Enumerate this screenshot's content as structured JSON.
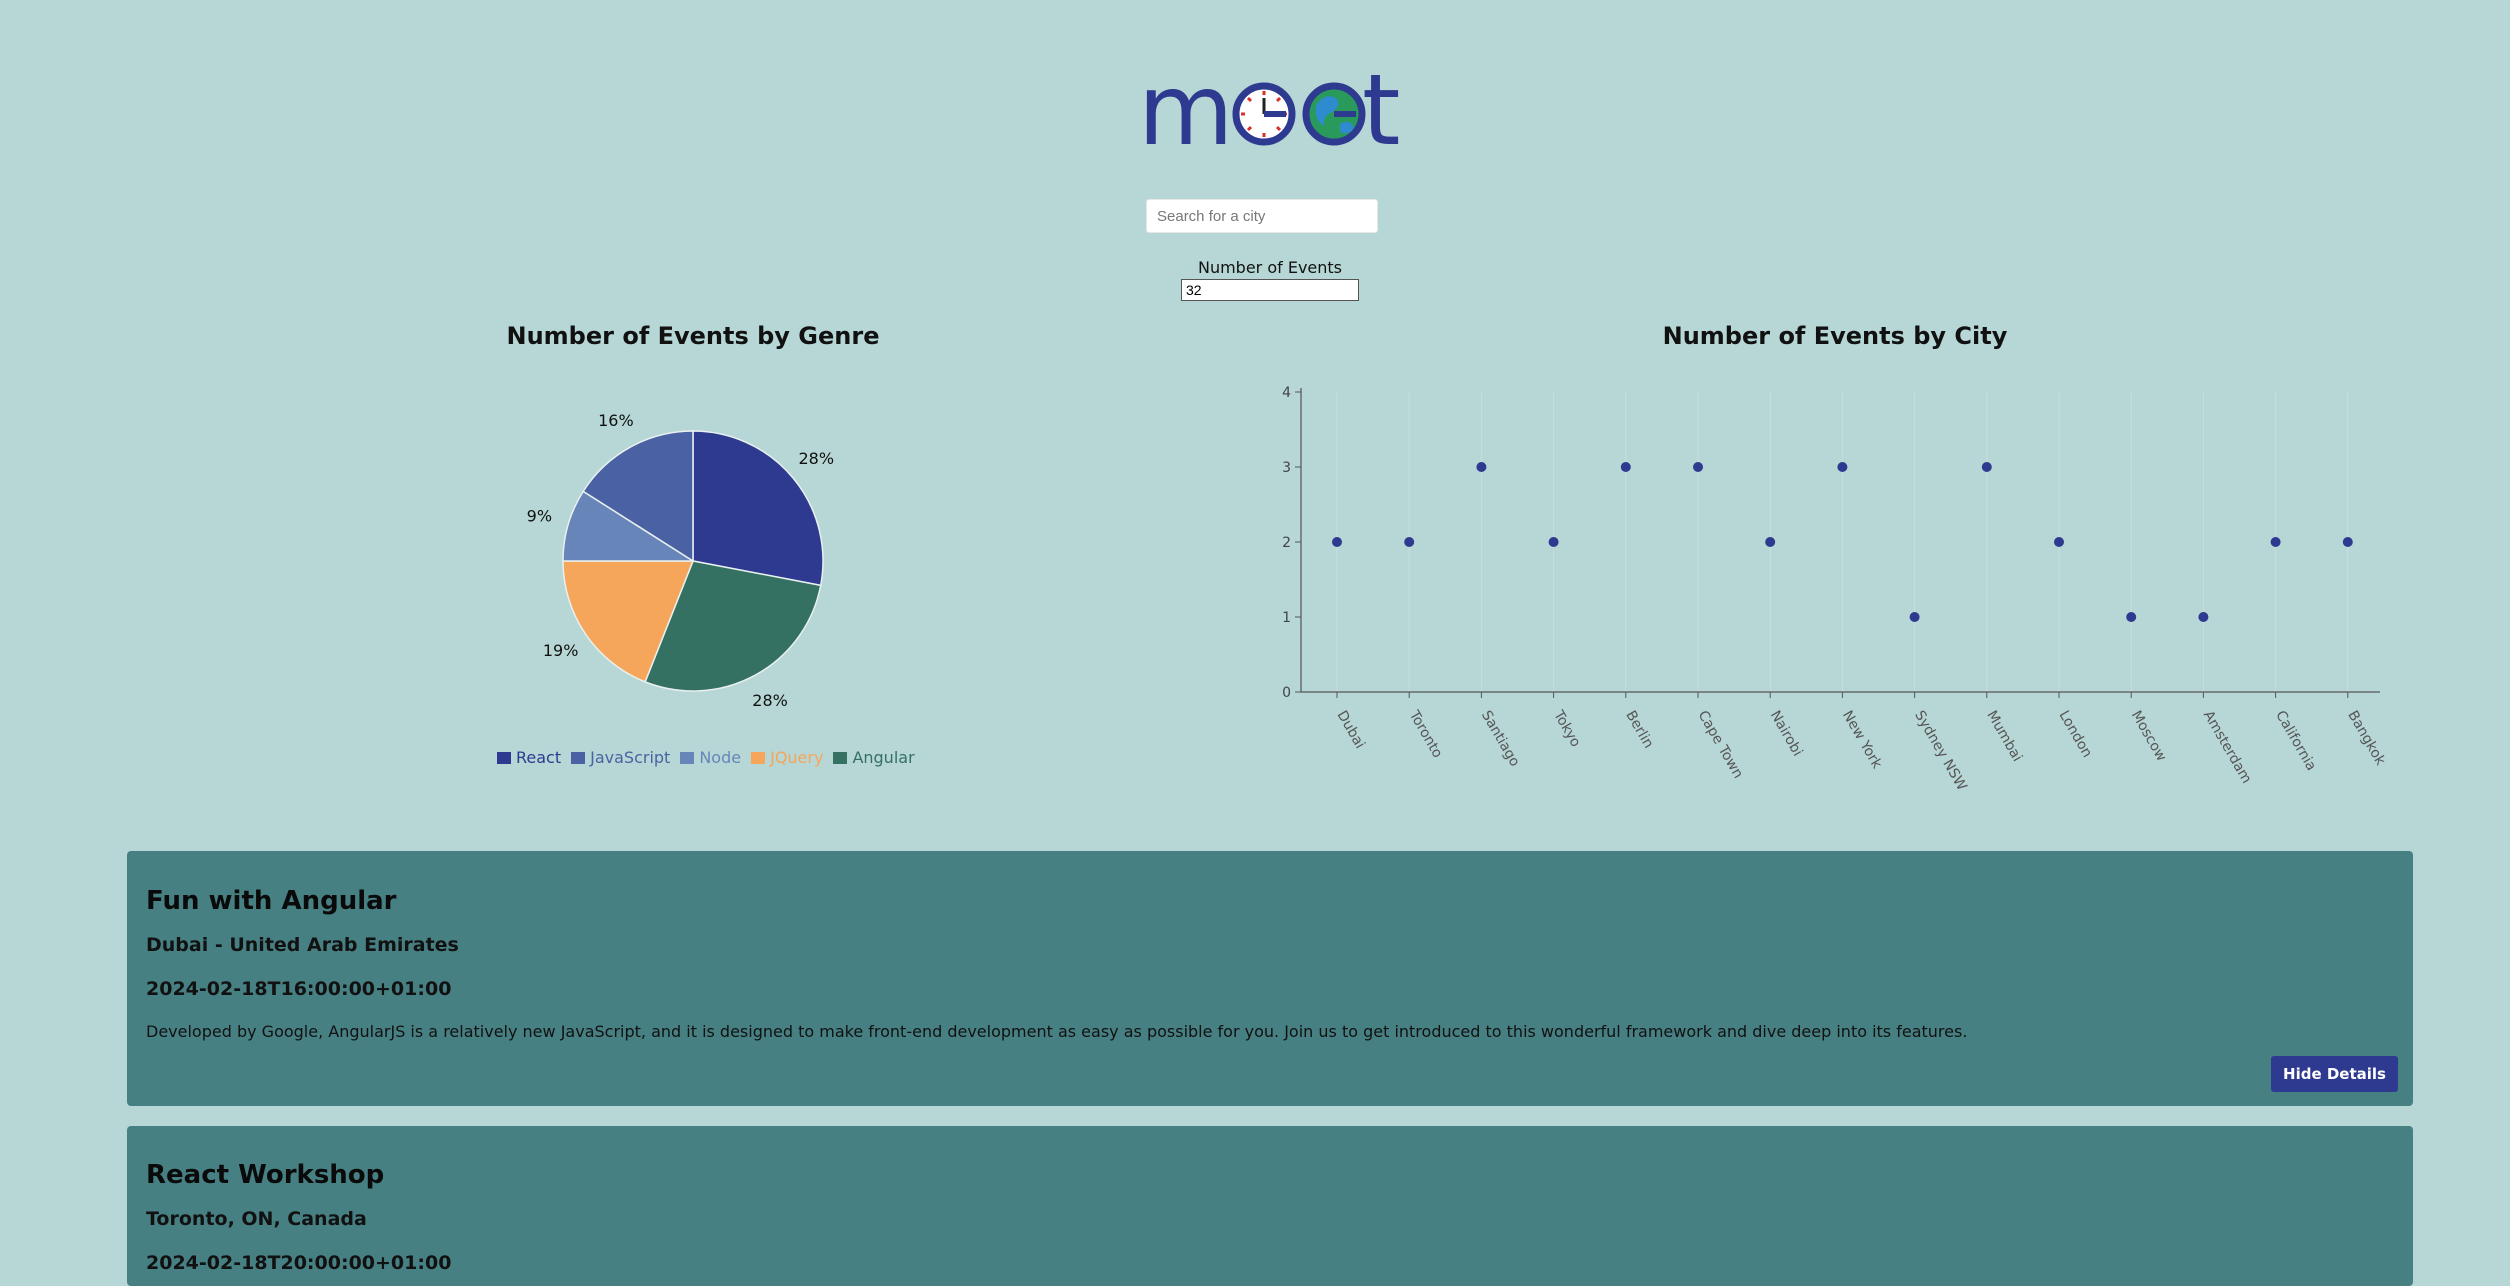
{
  "logo": {
    "text_m": "m",
    "text_t": "t",
    "icon1": "clock-icon",
    "icon2": "globe-icon"
  },
  "search": {
    "placeholder": "Search for a city",
    "value": ""
  },
  "number_of_events": {
    "label": "Number of Events",
    "value": "32"
  },
  "colors": {
    "background": "#b7d6d6",
    "card": "#478083",
    "button": "#2e3a8f",
    "react": "#2e3a8f",
    "javascript": "#4a62a4",
    "node": "#6785b9",
    "jquery": "#f6a65a",
    "angular": "#347163",
    "dot": "#2e3a8f"
  },
  "chart_data": [
    {
      "type": "pie",
      "title": "Number of Events by Genre",
      "labels": [
        "React",
        "JavaScript",
        "Node",
        "JQuery",
        "Angular"
      ],
      "values": [
        28,
        16,
        9,
        19,
        28
      ],
      "value_labels": [
        "28%",
        "16%",
        "9%",
        "19%",
        "28%"
      ],
      "legend": "bottom"
    },
    {
      "type": "scatter",
      "title": "Number of Events by City",
      "categories": [
        "Dubai",
        "Toronto",
        "Santiago",
        "Tokyo",
        "Berlin",
        "Cape Town",
        "Nairobi",
        "New York",
        "Sydney NSW",
        "Mumbai",
        "London",
        "Moscow",
        "Amsterdam",
        "California",
        "Bangkok"
      ],
      "values": [
        2,
        2,
        3,
        2,
        3,
        3,
        2,
        3,
        1,
        3,
        2,
        1,
        1,
        2,
        2
      ],
      "ylim": [
        0,
        4
      ],
      "yticks": [
        "0",
        "1",
        "2",
        "3",
        "4"
      ],
      "grid": true
    }
  ],
  "events": [
    {
      "title": "Fun with Angular",
      "location": "Dubai - United Arab Emirates",
      "date": "2024-02-18T16:00:00+01:00",
      "description": "Developed by Google, AngularJS is a relatively new JavaScript, and it is designed to make front-end development as easy as possible for you. Join us to get introduced to this wonderful framework and dive deep into its features.",
      "button_label": "Hide Details"
    },
    {
      "title": "React Workshop",
      "location": "Toronto, ON, Canada",
      "date": "2024-02-18T20:00:00+01:00"
    }
  ]
}
